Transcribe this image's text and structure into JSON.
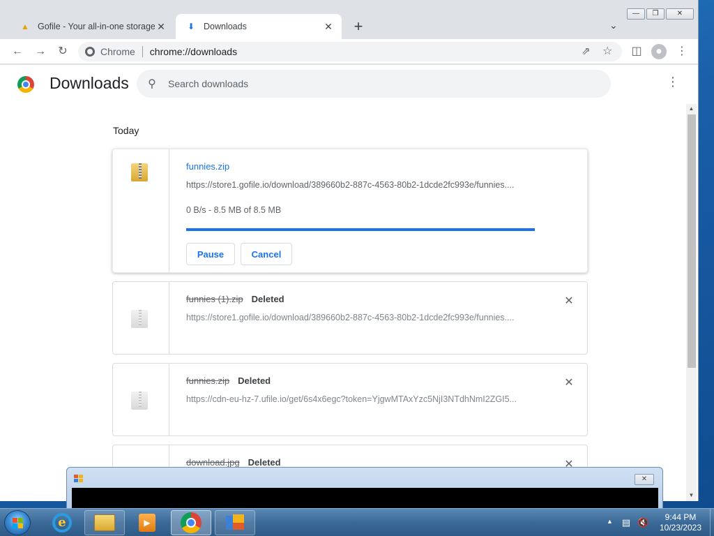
{
  "browser": {
    "tabs": [
      {
        "title": "Gofile - Your all-in-one storage s",
        "active": false
      },
      {
        "title": "Downloads",
        "active": true
      }
    ],
    "omnibox": {
      "chip": "Chrome",
      "url": "chrome://downloads"
    }
  },
  "page": {
    "title": "Downloads",
    "search_placeholder": "Search downloads",
    "section_label": "Today"
  },
  "downloads": [
    {
      "filename": "funnies.zip",
      "url": "https://store1.gofile.io/download/389660b2-887c-4563-80b2-1dcde2fc993e/funnies....",
      "status": "0 B/s - 8.5 MB of 8.5 MB",
      "progress": 1.0,
      "pause_label": "Pause",
      "cancel_label": "Cancel"
    },
    {
      "filename": "funnies (1).zip",
      "tag": "Deleted",
      "url": "https://store1.gofile.io/download/389660b2-887c-4563-80b2-1dcde2fc993e/funnies...."
    },
    {
      "filename": "funnies.zip",
      "tag": "Deleted",
      "url": "https://cdn-eu-hz-7.ufile.io/get/6s4x6egc?token=YjgwMTAxYzc5NjI3NTdhNmI2ZGI5..."
    },
    {
      "filename": "download.jpg",
      "tag": "Deleted"
    }
  ],
  "taskbar": {
    "clock_time": "9:44 PM",
    "clock_date": "10/23/2023"
  },
  "colors": {
    "accent": "#1a73e8",
    "text": "#202124",
    "muted": "#5f6368",
    "taskbar": "#3c6a98"
  }
}
